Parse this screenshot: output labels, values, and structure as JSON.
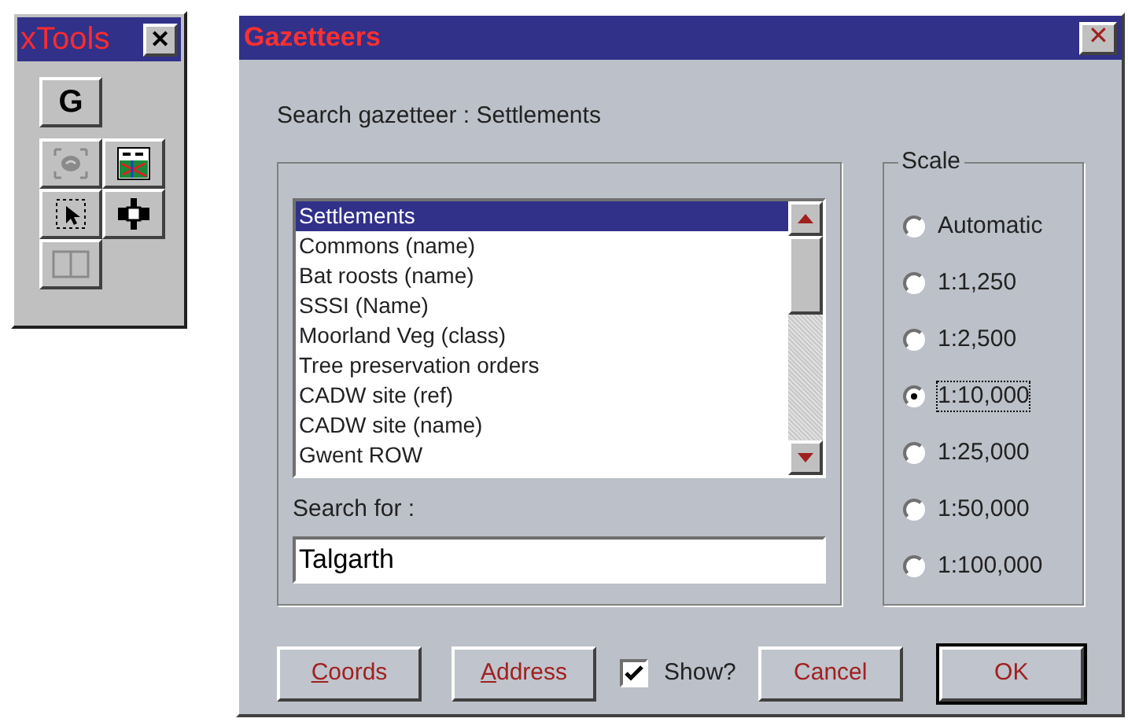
{
  "toolbox": {
    "title": "xTools",
    "close": "✕",
    "tools": [
      {
        "kind": "letter",
        "label": "G",
        "disabled": false
      },
      {
        "kind": "rotate",
        "disabled": true
      },
      {
        "kind": "map",
        "disabled": false
      },
      {
        "kind": "select",
        "disabled": false
      },
      {
        "kind": "move",
        "disabled": false
      },
      {
        "kind": "panel",
        "disabled": true
      }
    ]
  },
  "dialog": {
    "title": "Gazetteers",
    "close": "✕",
    "heading": "Search gazetteer : Settlements",
    "list": {
      "items": [
        {
          "label": "Settlements",
          "selected": true
        },
        {
          "label": "Commons (name)",
          "selected": false
        },
        {
          "label": "Bat roosts (name)",
          "selected": false
        },
        {
          "label": "SSSI (Name)",
          "selected": false
        },
        {
          "label": "Moorland Veg (class)",
          "selected": false
        },
        {
          "label": "Tree preservation orders",
          "selected": false
        },
        {
          "label": "CADW site (ref)",
          "selected": false
        },
        {
          "label": "CADW site (name)",
          "selected": false
        },
        {
          "label": "Gwent ROW",
          "selected": false
        }
      ]
    },
    "search_label": "Search for :",
    "search_value": "Talgarth",
    "scale": {
      "title": "Scale",
      "options": [
        {
          "label": "Automatic",
          "selected": false
        },
        {
          "label": "1:1,250",
          "selected": false
        },
        {
          "label": "1:2,500",
          "selected": false
        },
        {
          "label": "1:10,000",
          "selected": true
        },
        {
          "label": "1:25,000",
          "selected": false
        },
        {
          "label": "1:50,000",
          "selected": false
        },
        {
          "label": "1:100,000",
          "selected": false
        }
      ]
    },
    "buttons": [
      {
        "kind": "button",
        "label": "Coords",
        "mnemonic": true,
        "default": false
      },
      {
        "kind": "button",
        "label": "Address",
        "mnemonic": true,
        "default": false
      },
      {
        "kind": "checkbox",
        "label": "Show?",
        "checked": true
      },
      {
        "kind": "button",
        "label": "Cancel",
        "mnemonic": false,
        "default": false
      },
      {
        "kind": "button",
        "label": "OK",
        "mnemonic": false,
        "default": true
      }
    ]
  }
}
